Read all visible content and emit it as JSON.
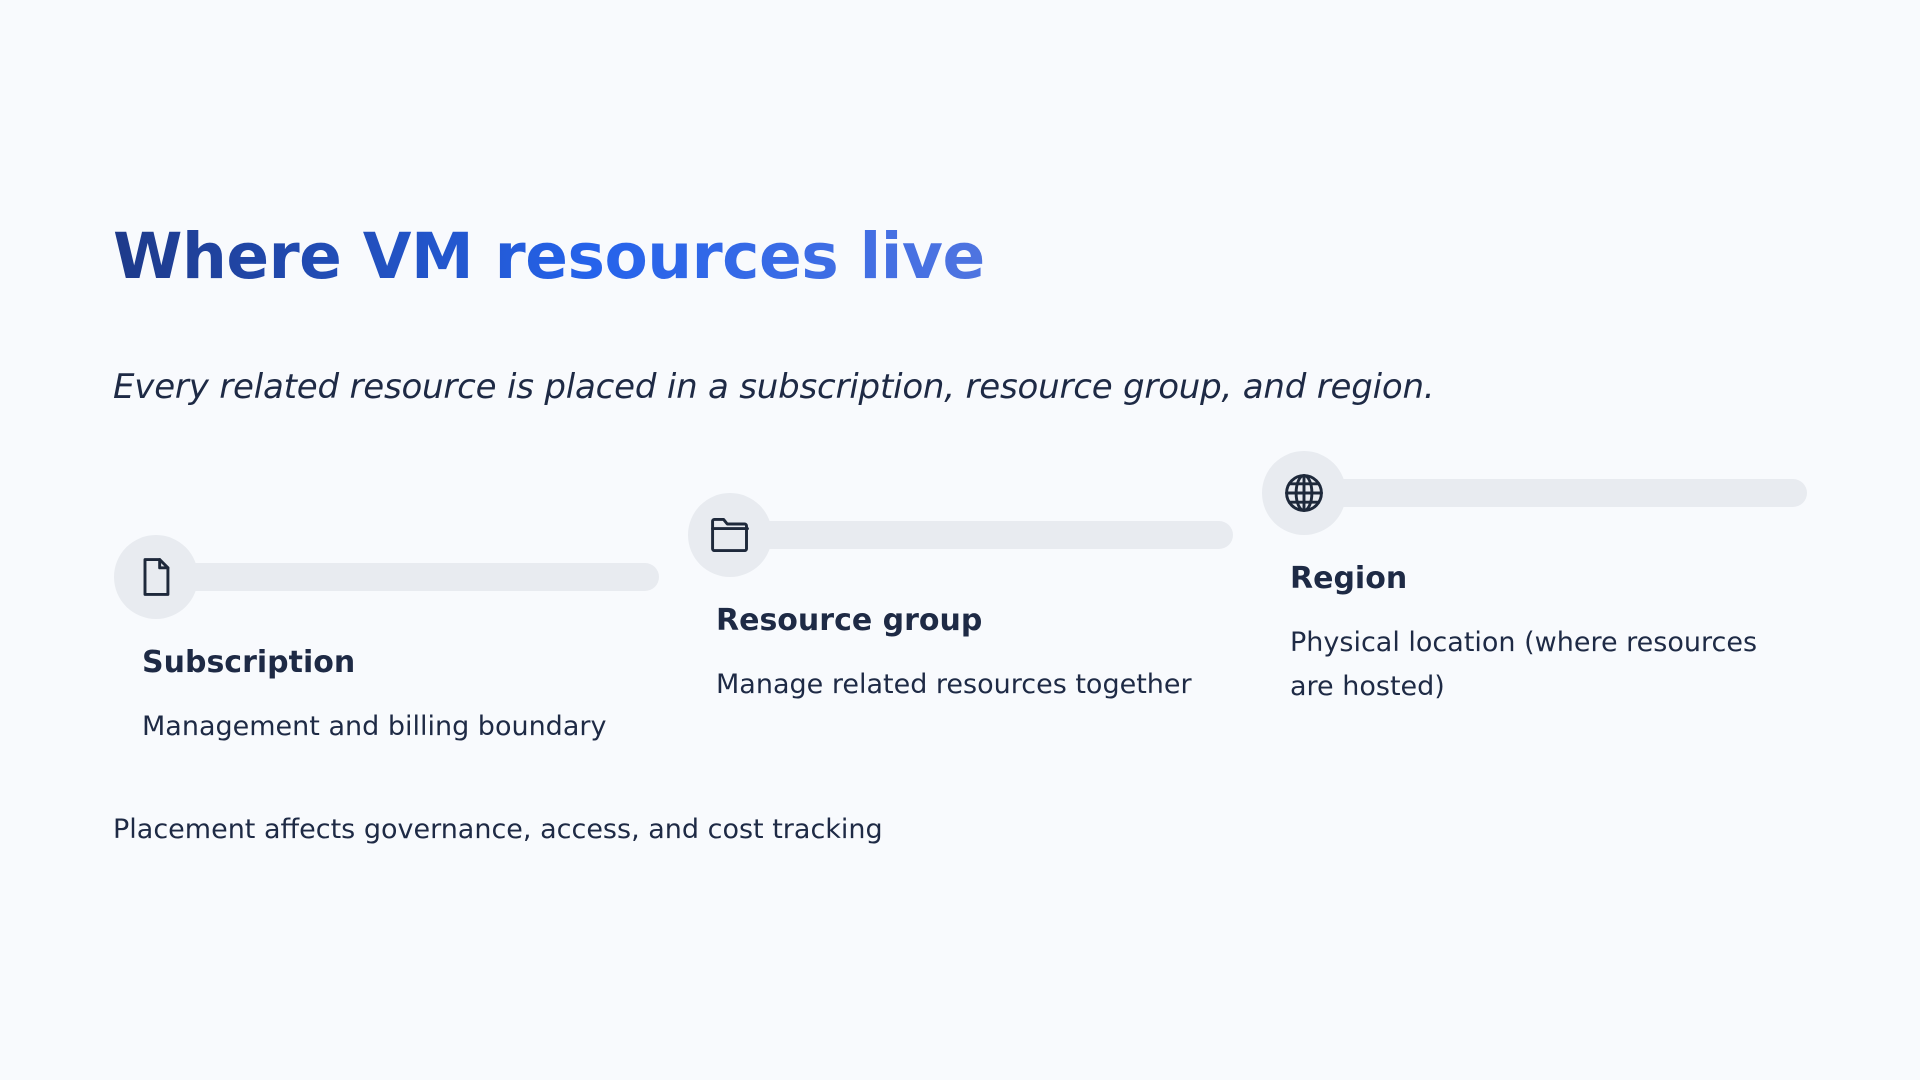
{
  "slide": {
    "title": "Where VM resources live",
    "subtitle": "Every related resource is placed in a subscription, resource group, and region.",
    "footer": "Placement affects governance, access, and cost tracking",
    "cards": [
      {
        "icon": "document-icon",
        "title": "Subscription",
        "description": "Management and billing boundary"
      },
      {
        "icon": "folder-icon",
        "title": "Resource group",
        "description": "Manage related resources together"
      },
      {
        "icon": "globe-icon",
        "title": "Region",
        "description": "Physical location (where resources are hosted)"
      }
    ],
    "colors": {
      "background": "#f8fafd",
      "title_gradient_start": "#1e3a8a",
      "title_gradient_end": "#4f74e0",
      "track": "#e8ebf0",
      "text": "#1e2a45"
    }
  }
}
